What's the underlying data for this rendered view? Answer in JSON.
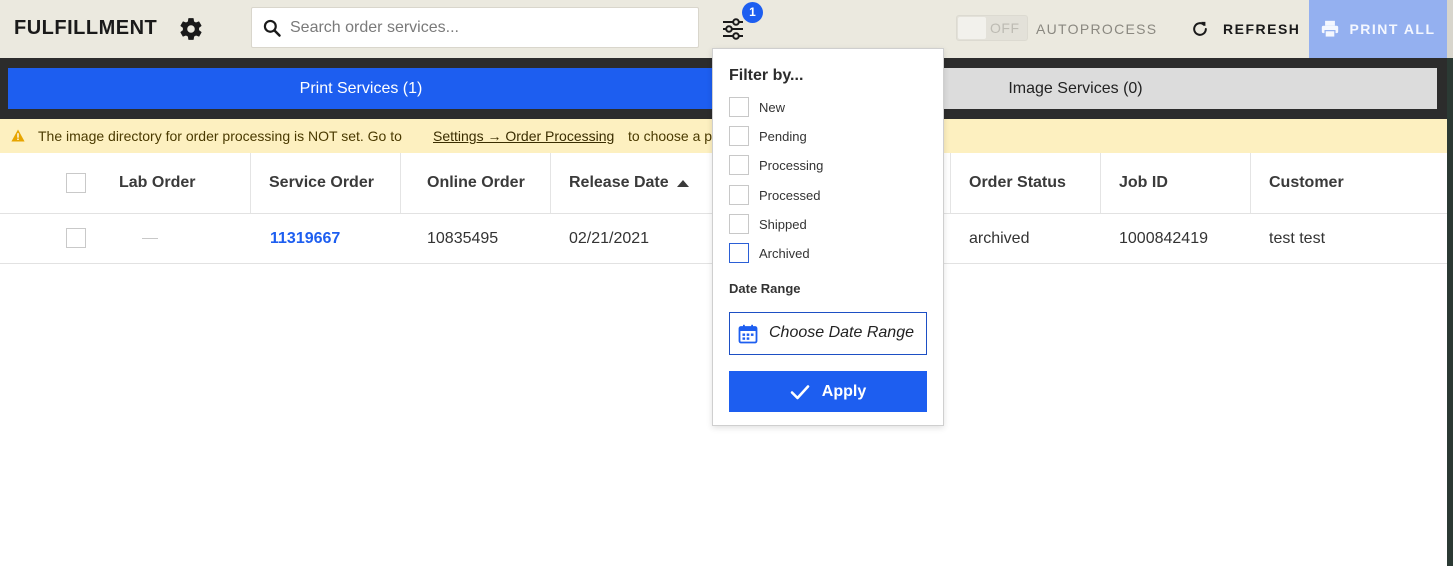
{
  "header": {
    "app_title": "FULFILLMENT",
    "search_placeholder": "Search order services...",
    "filter_badge_count": "1",
    "autoprocess_toggle_state": "OFF",
    "autoprocess_label": "AUTOPROCESS",
    "refresh_label": "REFRESH",
    "print_all_label": "PRINT ALL"
  },
  "tabs": [
    {
      "label": "Print Services (1)",
      "active": true
    },
    {
      "label": "Image Services (0)",
      "active": false
    }
  ],
  "warning": {
    "text_before": "The image directory for order processing is NOT set. Go to",
    "link": "Settings → Order Processing",
    "text_after": "to choose a p"
  },
  "table": {
    "columns": [
      "Lab Order",
      "Service Order",
      "Online Order",
      "Release Date",
      "Order Status",
      "Job ID",
      "Customer"
    ],
    "sorted_column": "Release Date",
    "sort_direction": "ascending",
    "rows": [
      {
        "lab_order": "",
        "service_order": "11319667",
        "online_order": "10835495",
        "release_date": "02/21/2021",
        "order_status": "archived",
        "job_id": "1000842419",
        "customer": "test test"
      }
    ]
  },
  "filter_menu": {
    "title": "Filter by...",
    "options": [
      {
        "label": "New",
        "checked": false
      },
      {
        "label": "Pending",
        "checked": false
      },
      {
        "label": "Processing",
        "checked": false
      },
      {
        "label": "Processed",
        "checked": false
      },
      {
        "label": "Shipped",
        "checked": false
      },
      {
        "label": "Archived",
        "checked": false
      }
    ],
    "date_range_label": "Date Range",
    "date_range_placeholder": "Choose Date Range",
    "apply_label": "Apply"
  },
  "colors": {
    "accent": "#1d5ef0",
    "header_bg": "#ebe9df",
    "print_all_disabled": "#94b0f0",
    "warning_bg": "#fdf0c0",
    "tabs_bar_bg": "#2c2c2c"
  },
  "icons": [
    "gear-icon",
    "search-icon",
    "filter-sliders-icon",
    "refresh-icon",
    "printer-icon",
    "warning-icon",
    "calendar-icon",
    "checkmark-icon"
  ]
}
